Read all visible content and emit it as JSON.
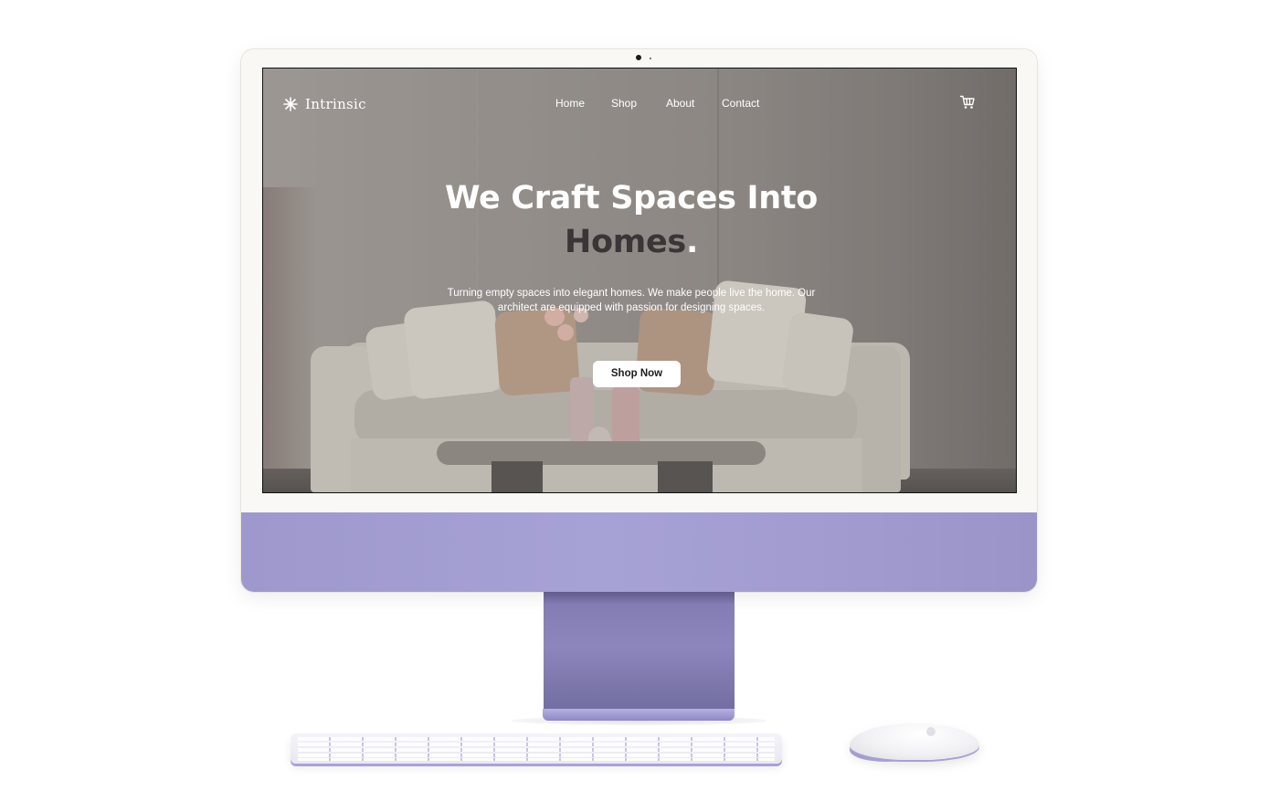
{
  "site": {
    "brand": "Intrinsic",
    "nav": [
      "Home",
      "Shop",
      "About",
      "Contact"
    ],
    "hero": {
      "headline_line1": "We Craft Spaces Into",
      "headline_line2": "Homes",
      "headline_dot": ".",
      "subtext": "Turning empty spaces into elegant homes. We make people live the home. Our architect are equipped with passion for designing spaces.",
      "cta_label": "Shop Now"
    }
  },
  "icons": {
    "logo": "sparkle-icon",
    "cart": "cart-icon"
  },
  "colors": {
    "accent_dark_text": "#3a3536",
    "cta_background": "#ffffff",
    "device_color": "#a7a2d6"
  }
}
